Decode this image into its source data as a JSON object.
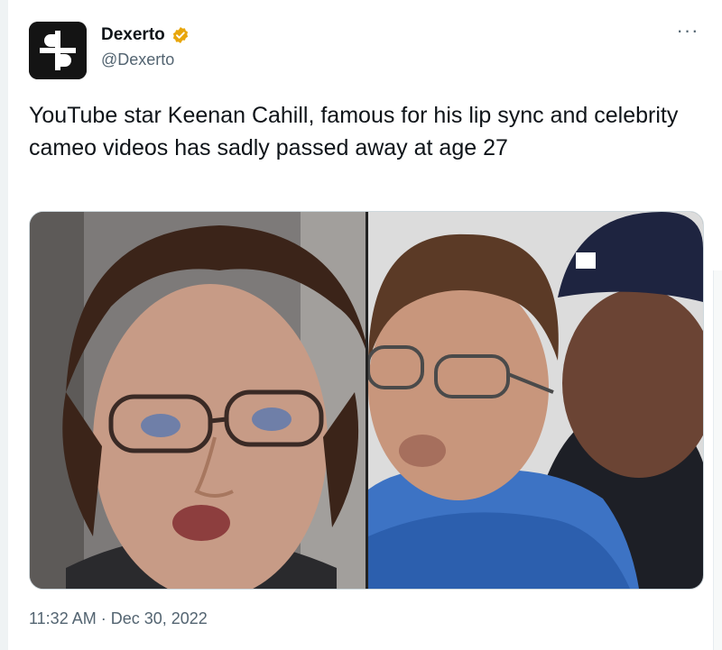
{
  "account": {
    "display_name": "Dexerto",
    "handle": "@Dexerto",
    "avatar_icon": "dexerto-logo-icon",
    "verified_icon": "verified-badge-icon",
    "verified_color": "#e8a60c"
  },
  "more_button_label": "···",
  "tweet": {
    "text": "YouTube star Keenan Cahill, famous for his lip sync and celebrity cameo videos has sadly passed away at age 27"
  },
  "media": {
    "left_image": "photo-keenan-cahill-portrait",
    "right_image": "photo-keenan-cahill-with-50-cent"
  },
  "meta": {
    "time": "11:32 AM",
    "separator": " · ",
    "date": "Dec 30, 2022"
  },
  "colors": {
    "text_primary": "#0f1419",
    "text_secondary": "#536471",
    "border": "#cfd9de"
  }
}
